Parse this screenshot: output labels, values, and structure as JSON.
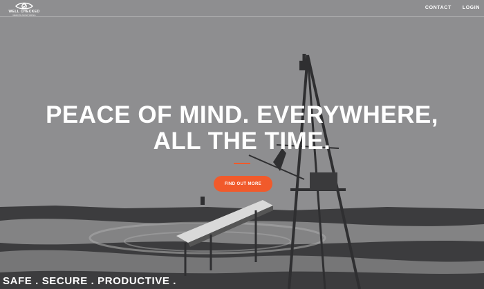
{
  "brand": {
    "name": "WELL CHECKED",
    "tagline": "REMOTE MONITORING"
  },
  "nav": {
    "contact": "CONTACT",
    "login": "LOGIN"
  },
  "hero": {
    "headline_line1": "PEACE OF MIND. EVERYWHERE,",
    "headline_line2": "ALL THE TIME.",
    "cta_label": "FIND OUT MORE",
    "tagline": "SAFE . SECURE . PRODUCTIVE ."
  },
  "colors": {
    "accent": "#f15a2b",
    "background": "#8e8e90",
    "text": "#ffffff"
  }
}
